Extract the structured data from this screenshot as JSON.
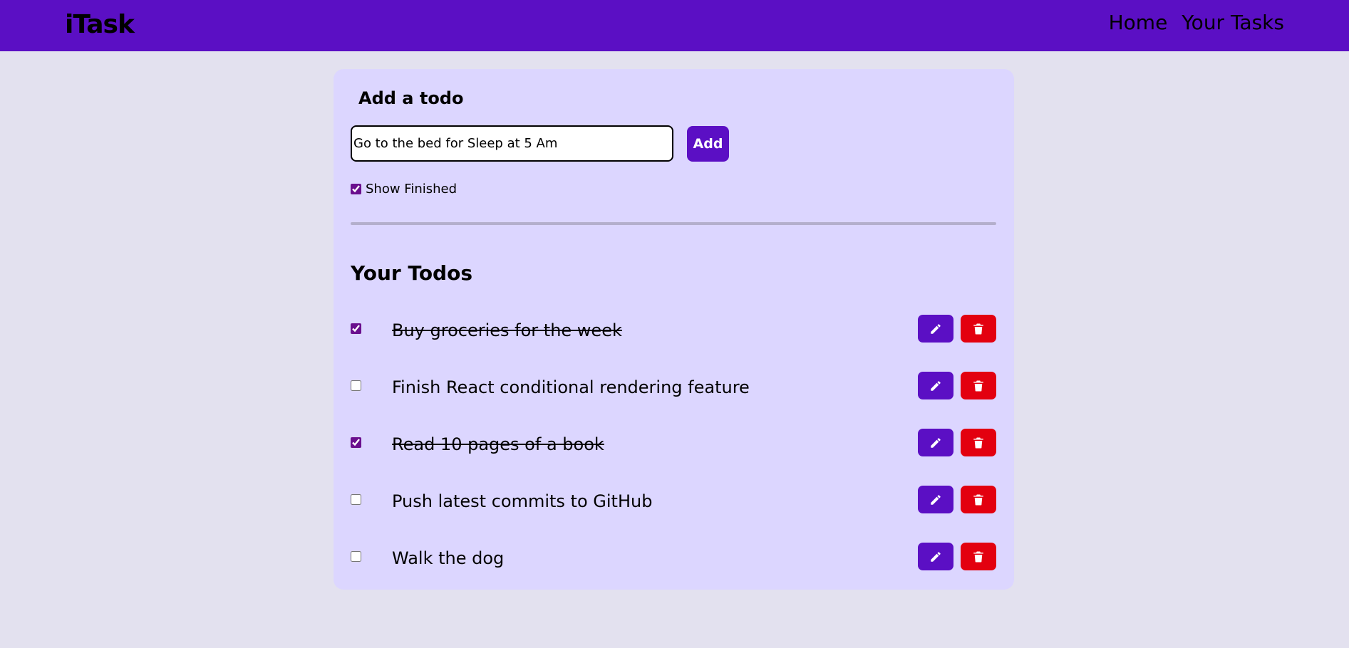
{
  "nav": {
    "brand": "iTask",
    "links": [
      "Home",
      "Your Tasks"
    ]
  },
  "add_section": {
    "heading": "Add a todo",
    "input_value": "Go to the bed for Sleep at 5 Am",
    "add_label": "Add",
    "show_finished_label": "Show Finished",
    "show_finished_checked": true
  },
  "todos_section": {
    "heading": "Your Todos",
    "items": [
      {
        "text": "Buy groceries for the week",
        "done": true
      },
      {
        "text": "Finish React conditional rendering feature",
        "done": false
      },
      {
        "text": "Read 10 pages of a book",
        "done": true
      },
      {
        "text": "Push latest commits to GitHub",
        "done": false
      },
      {
        "text": "Walk the dog",
        "done": false
      }
    ],
    "edit_icon": "pencil-icon",
    "delete_icon": "trash-icon"
  },
  "colors": {
    "nav_bg": "#5b0fc4",
    "page_bg": "#e3e1ef",
    "card_bg": "#dcd6ff",
    "edit_button": "#5b0fc4",
    "delete_button": "#e3000f",
    "checkbox": "#6a0f8e"
  }
}
